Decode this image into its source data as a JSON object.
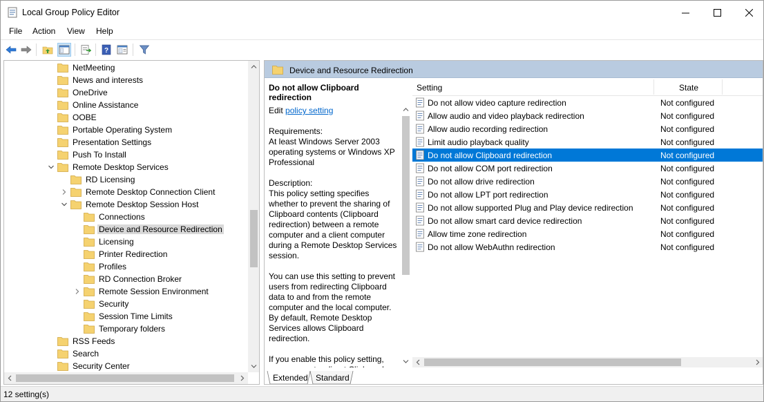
{
  "window": {
    "title": "Local Group Policy Editor"
  },
  "menu": [
    "File",
    "Action",
    "View",
    "Help"
  ],
  "tree": {
    "items": [
      {
        "label": "NetMeeting"
      },
      {
        "label": "News and interests"
      },
      {
        "label": "OneDrive"
      },
      {
        "label": "Online Assistance"
      },
      {
        "label": "OOBE"
      },
      {
        "label": "Portable Operating System"
      },
      {
        "label": "Presentation Settings"
      },
      {
        "label": "Push To Install"
      },
      {
        "label": "Remote Desktop Services"
      },
      {
        "label": "RD Licensing"
      },
      {
        "label": "Remote Desktop Connection Client"
      },
      {
        "label": "Remote Desktop Session Host"
      },
      {
        "label": "Connections"
      },
      {
        "label": "Device and Resource Redirection"
      },
      {
        "label": "Licensing"
      },
      {
        "label": "Printer Redirection"
      },
      {
        "label": "Profiles"
      },
      {
        "label": "RD Connection Broker"
      },
      {
        "label": "Remote Session Environment"
      },
      {
        "label": "Security"
      },
      {
        "label": "Session Time Limits"
      },
      {
        "label": "Temporary folders"
      },
      {
        "label": "RSS Feeds"
      },
      {
        "label": "Search"
      },
      {
        "label": "Security Center"
      }
    ]
  },
  "right_header": {
    "title": "Device and Resource Redirection"
  },
  "description": {
    "title": "Do not allow Clipboard redirection",
    "edit_prefix": "Edit",
    "edit_link": "policy setting",
    "requirements": "Requirements:\nAt least Windows Server 2003 operating systems or Windows XP Professional",
    "description": "Description:\nThis policy setting specifies whether to prevent the sharing of Clipboard contents (Clipboard redirection) between a remote computer and a client computer during a Remote Desktop Services session.",
    "para2": "You can use this setting to prevent users from redirecting Clipboard data to and from the remote computer and the local computer. By default, Remote Desktop Services allows Clipboard redirection.",
    "para3": "If you enable this policy setting, users cannot redirect Clipboard"
  },
  "list": {
    "col_setting": "Setting",
    "col_state": "State",
    "rows": [
      {
        "name": "Do not allow video capture redirection",
        "state": "Not configured"
      },
      {
        "name": "Allow audio and video playback redirection",
        "state": "Not configured"
      },
      {
        "name": "Allow audio recording redirection",
        "state": "Not configured"
      },
      {
        "name": "Limit audio playback quality",
        "state": "Not configured"
      },
      {
        "name": "Do not allow Clipboard redirection",
        "state": "Not configured"
      },
      {
        "name": "Do not allow COM port redirection",
        "state": "Not configured"
      },
      {
        "name": "Do not allow drive redirection",
        "state": "Not configured"
      },
      {
        "name": "Do not allow LPT port redirection",
        "state": "Not configured"
      },
      {
        "name": "Do not allow supported Plug and Play device redirection",
        "state": "Not configured"
      },
      {
        "name": "Do not allow smart card device redirection",
        "state": "Not configured"
      },
      {
        "name": "Allow time zone redirection",
        "state": "Not configured"
      },
      {
        "name": "Do not allow WebAuthn redirection",
        "state": "Not configured"
      }
    ]
  },
  "tabs": [
    "Extended",
    "Standard"
  ],
  "status": {
    "text": "12 setting(s)"
  },
  "colors": {
    "selection": "#0078d7",
    "header_bg": "#b9cbe0",
    "folder": "#f5d270",
    "link": "#0066cc"
  }
}
